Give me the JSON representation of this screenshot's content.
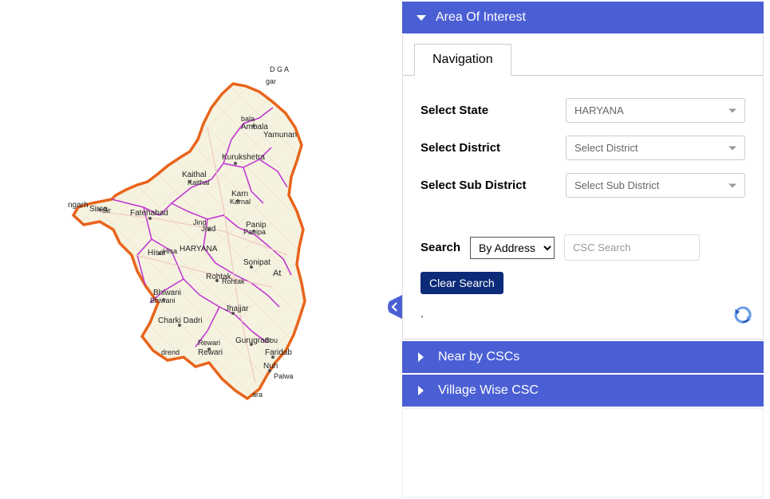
{
  "accordion": {
    "area_of_interest": "Area Of Interest",
    "near_by_cscs": "Near by CSCs",
    "village_wise_csc": "Village Wise CSC"
  },
  "tab": {
    "navigation": "Navigation"
  },
  "form": {
    "state_label": "Select State",
    "state_value": "HARYANA",
    "district_label": "Select District",
    "district_value": "Select District",
    "subdistrict_label": "Select Sub District",
    "subdistrict_value": "Select Sub District"
  },
  "search": {
    "label": "Search",
    "mode": "By Address",
    "placeholder": "CSC Search"
  },
  "buttons": {
    "clear": "Clear Search"
  },
  "map": {
    "state": "HARYANA",
    "districts": [
      "Sirsa",
      "Fatehabad",
      "Hisar",
      "Bhiwani",
      "Charki Dadri",
      "Kaithal",
      "Jind",
      "Karnal",
      "Kurukshetra",
      "Ambala",
      "Yamunanagar",
      "Panipat",
      "Sonipat",
      "Rohtak",
      "Jhajjar",
      "Rewari",
      "Gurugram",
      "Faridabad",
      "Nuh",
      "Palwal"
    ],
    "neighbor_labels": [
      "ngarh",
      "D G A",
      "gar"
    ],
    "state_label": "HARYANA"
  }
}
